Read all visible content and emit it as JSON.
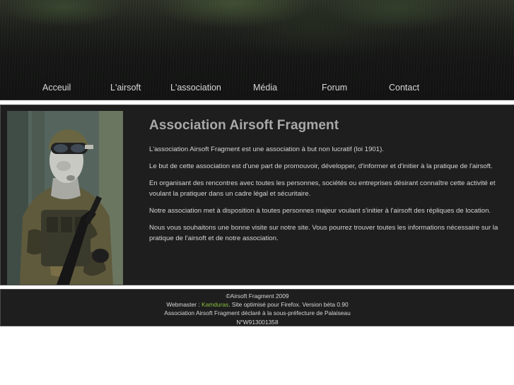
{
  "nav": {
    "items": [
      {
        "label": "Acceuil"
      },
      {
        "label": "L'airsoft"
      },
      {
        "label": "L'association"
      },
      {
        "label": "Média"
      },
      {
        "label": "Forum"
      },
      {
        "label": "Contact"
      }
    ]
  },
  "main": {
    "title": "Association Airsoft Fragment",
    "paragraphs": [
      "L'association Airsoft Fragment est une association à but non lucratif (loi 1901).",
      "Le but de cette association est d'une part de promouvoir, développer, d'informer et d'initier à la pratique de l'airsoft.",
      "En organisant des rencontres avec toutes les personnes, sociétés ou entreprises désirant connaître cette activité et voulant la pratiquer dans un cadre légal et sécuritaire.",
      "Notre association met à disposition à toutes personnes majeur voulant s'initier à l'airsoft des répliques de location.",
      "Nous vous souhaitons une bonne visite sur notre site. Vous pourrez trouver toutes les informations nécessaire sur la pratique de l'airsoft et de notre association."
    ]
  },
  "footer": {
    "copyright": "©Airsoft Fragment 2009",
    "webmaster_prefix": "Webmaster : ",
    "webmaster_name": "Kamduras",
    "webmaster_suffix": ". Site optimisé pour Firefox. Version béta 0.90",
    "declaration": "Association Airsoft Fragment déclaré à la sous-préfecture de Palaiseau",
    "registration": "N°W913001358"
  },
  "colors": {
    "background": "#1e1e1e",
    "title": "#a9a9a9",
    "text": "#d6d6d6",
    "link": "#8bbf3e"
  }
}
